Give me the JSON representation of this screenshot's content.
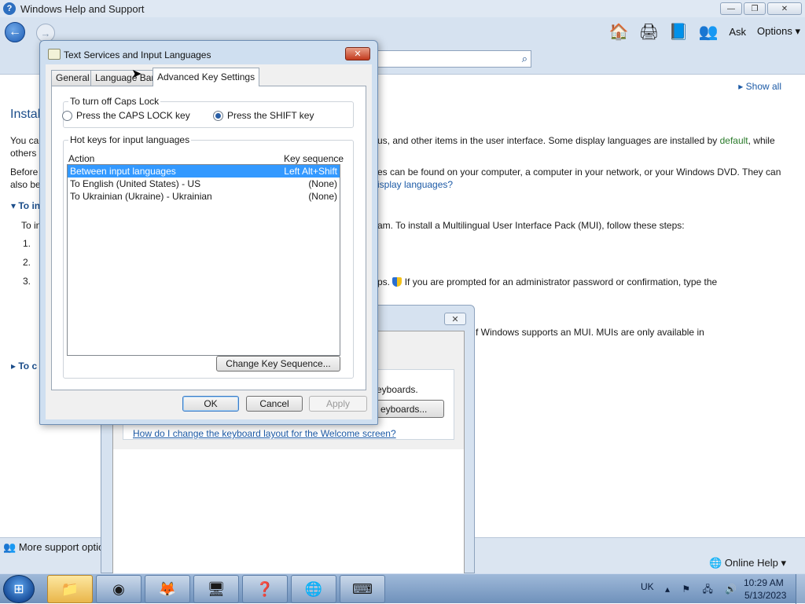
{
  "help_window": {
    "title": "Windows Help and Support",
    "toolbar": {
      "ask_label": "Ask",
      "options_label": "Options"
    },
    "show_all": "Show all",
    "heading": "Instal",
    "para1_line1_left": "You ca",
    "para1_line1_right": "us, and other items in the user interface. Some display languages are installed by",
    "para1_default_link": "default",
    "para1_line1_end": ", while",
    "para1_line2_left": "others",
    "para2_line1_left": "Before",
    "para2_line1_right": "es can be found on your computer, a computer in your network, or your Windows DVD. They can",
    "para2_line2_left": "also be",
    "para2_line2_link": "isplay languages?",
    "section1_label": "To in",
    "section1_sub_left": "To in",
    "section1_sub_right": "am. To install a Multilingual User Interface Pack (MUI), follow these steps:",
    "steps": [
      "1.",
      "2.",
      "3."
    ],
    "step3_right": "ps.",
    "step3_right2": "If you are prompted for an administrator password or confirmation, type the",
    "mui_note": "f Windows supports an MUI. MUIs are only available in",
    "section2_label": "To c",
    "more_support": "More support optio",
    "online_help": "Online Help"
  },
  "region_dialog": {
    "keyboards_text": "eyboards.",
    "change_keyboards_btn": "eyboards...",
    "welcome_link": "How do I change the keyboard layout for the Welcome screen?"
  },
  "dialog": {
    "title": "Text Services and Input Languages",
    "tabs": [
      {
        "label": "General"
      },
      {
        "label": "Language Bar"
      },
      {
        "label": "Advanced Key Settings"
      }
    ],
    "caps_group": {
      "legend": "To turn off Caps Lock",
      "option_caps": "Press the CAPS LOCK key",
      "option_shift": "Press the SHIFT key",
      "selected": "option_shift"
    },
    "hotkeys_group": {
      "legend": "Hot keys for input languages",
      "col_action": "Action",
      "col_sequence": "Key sequence",
      "rows": [
        {
          "action": "Between input languages",
          "sequence": "Left Alt+Shift",
          "selected": true
        },
        {
          "action": "To English (United States) - US",
          "sequence": "(None)",
          "selected": false
        },
        {
          "action": "To Ukrainian (Ukraine) - Ukrainian",
          "sequence": "(None)",
          "selected": false
        }
      ],
      "change_seq_btn": "Change Key Sequence..."
    },
    "buttons": {
      "ok": "OK",
      "cancel": "Cancel",
      "apply": "Apply"
    }
  },
  "taskbar": {
    "language": "UK",
    "time": "10:29 AM",
    "date": "5/13/2023",
    "apps": [
      "windows-explorer",
      "chrome",
      "firefox",
      "control-panel",
      "help-and-support",
      "network",
      "input-languages"
    ]
  }
}
